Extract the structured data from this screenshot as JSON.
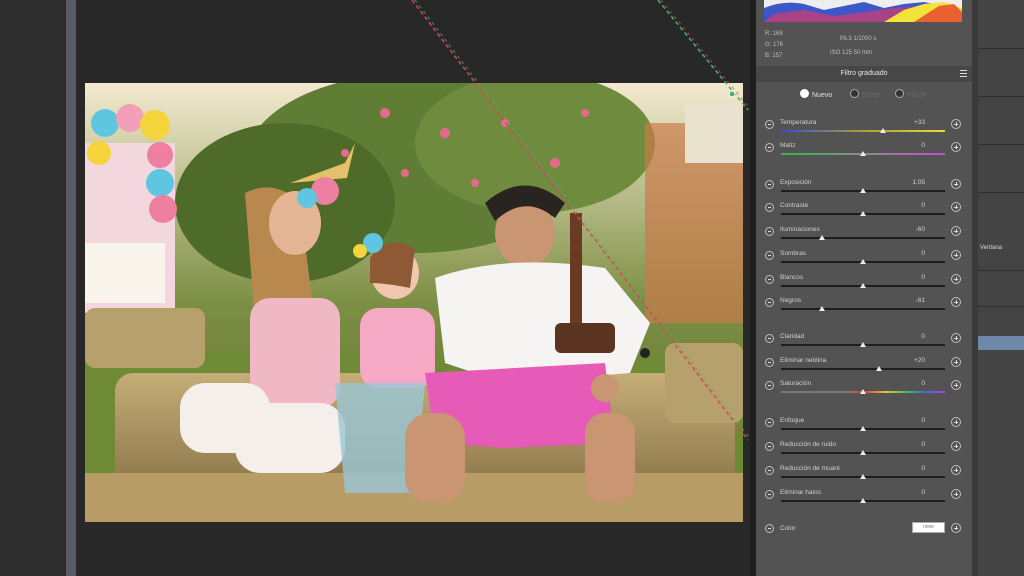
{
  "colors": {
    "panel_bg": "#535353",
    "workspace_bg": "#282828",
    "accent": "#6f87a8"
  },
  "histogram": {
    "readouts": {
      "r": "R:  168",
      "g": "G:  176",
      "b": "B:  157",
      "exposure_line1": "f/6.3    1/1000 s",
      "exposure_line2": "ISO 125    50 mm"
    }
  },
  "panel": {
    "title": "Filtro graduado",
    "menu_icon": "panel-menu-icon",
    "modes": [
      "Nuevo",
      "Editar",
      "Pincel"
    ],
    "selected_mode": "Nuevo",
    "sliders": [
      {
        "label": "Temperatura",
        "value": "+33",
        "level": 0.62
      },
      {
        "label": "Matiz",
        "value": "0",
        "level": 0.5
      },
      {
        "label": "Exposición",
        "value": "1,05",
        "level": 0.5
      },
      {
        "label": "Contraste",
        "value": "0",
        "level": 0.5
      },
      {
        "label": "Iluminaciones",
        "value": "-60",
        "level": 0.25
      },
      {
        "label": "Sombras",
        "value": "0",
        "level": 0.5
      },
      {
        "label": "Blancos",
        "value": "0",
        "level": 0.5
      },
      {
        "label": "Negros",
        "value": "-61",
        "level": 0.25
      },
      {
        "label": "Claridad",
        "value": "0",
        "level": 0.5
      },
      {
        "label": "Eliminar neblina",
        "value": "+20",
        "level": 0.6
      },
      {
        "label": "Saturación",
        "value": "0",
        "level": 0.5
      },
      {
        "label": "Enfoque",
        "value": "0",
        "level": 0.5
      },
      {
        "label": "Reducción de ruido",
        "value": "0",
        "level": 0.5
      },
      {
        "label": "Reducción de muaré",
        "value": "0",
        "level": 0.5
      },
      {
        "label": "Eliminar halos",
        "value": "0",
        "level": 0.5
      }
    ],
    "color_label": "Color",
    "color_value": "none"
  },
  "dock": {
    "label": "Ventana"
  }
}
